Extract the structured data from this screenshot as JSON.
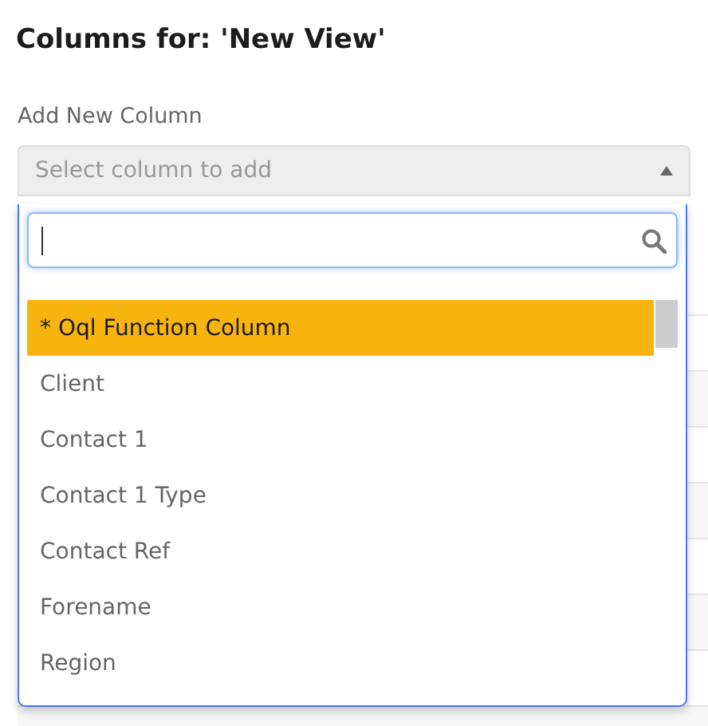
{
  "title": "Columns for: 'New View'",
  "add_column": {
    "label": "Add New Column",
    "placeholder": "Select column to add",
    "expanded": true
  },
  "dropdown": {
    "options": [
      {
        "label": "* Oql Function Column",
        "selected": true
      },
      {
        "label": "Client",
        "selected": false
      },
      {
        "label": "Contact 1",
        "selected": false
      },
      {
        "label": "Contact 1 Type",
        "selected": false
      },
      {
        "label": "Contact Ref",
        "selected": false
      },
      {
        "label": "Forename",
        "selected": false
      },
      {
        "label": "Region",
        "selected": false
      }
    ]
  }
}
